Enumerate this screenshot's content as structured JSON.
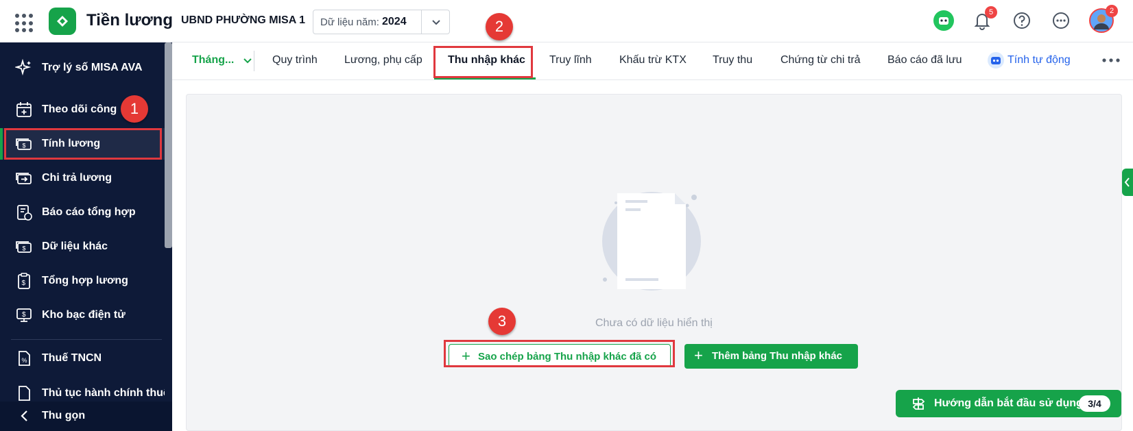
{
  "header": {
    "app_title": "Tiền lương",
    "org_name": "UBND PHƯỜNG MISA 1",
    "year_label": "Dữ liệu năm:",
    "year_value": "2024",
    "notification_count": "5",
    "avatar_badge": "2"
  },
  "sidebar": {
    "items": [
      {
        "label": "Trợ lý số MISA AVA"
      },
      {
        "label": "Theo dõi công"
      },
      {
        "label": "Tính lương"
      },
      {
        "label": "Chi trả lương"
      },
      {
        "label": "Báo cáo tổng hợp"
      },
      {
        "label": "Dữ liệu khác"
      },
      {
        "label": "Tổng hợp lương"
      },
      {
        "label": "Kho bạc điện tử"
      },
      {
        "label": "Thuế TNCN"
      },
      {
        "label": "Thủ tục hành chính thuế"
      }
    ],
    "active_index": 2,
    "collapse_label": "Thu gọn"
  },
  "tabs": {
    "month_selector": "Tháng...",
    "items": [
      {
        "label": "Quy trình"
      },
      {
        "label": "Lương, phụ cấp"
      },
      {
        "label": "Thu nhập khác"
      },
      {
        "label": "Truy lĩnh"
      },
      {
        "label": "Khấu trừ KTX"
      },
      {
        "label": "Truy thu"
      },
      {
        "label": "Chứng từ chi trả"
      },
      {
        "label": "Báo cáo đã lưu"
      }
    ],
    "active_index": 2,
    "auto_calc_label": "Tính tự động"
  },
  "content": {
    "empty_message": "Chưa có dữ liệu hiển thị",
    "copy_button_label": "Sao chép bảng Thu nhập khác đã có",
    "add_button_label": "Thêm bảng Thu nhập khác"
  },
  "guide": {
    "label": "Hướng dẫn bắt đầu sử dụng",
    "progress": "3/4"
  },
  "annotations": {
    "step1": "1",
    "step2": "2",
    "step3": "3"
  },
  "colors": {
    "brand_green": "#16a34a",
    "sidebar_bg": "#0e1a38",
    "annotation_red": "#e53935",
    "link_blue": "#2563eb"
  }
}
